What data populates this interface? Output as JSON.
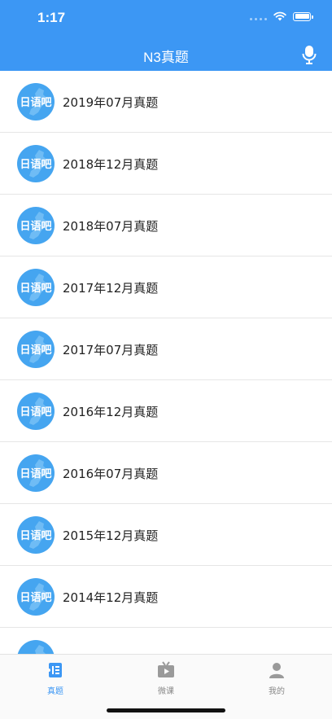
{
  "status": {
    "time": "1:17"
  },
  "nav": {
    "title": "N3真题"
  },
  "logo_text": "日语吧",
  "exams": [
    {
      "label": "2019年07月真题"
    },
    {
      "label": "2018年12月真题"
    },
    {
      "label": "2018年07月真题"
    },
    {
      "label": "2017年12月真题"
    },
    {
      "label": "2017年07月真题"
    },
    {
      "label": "2016年12月真题"
    },
    {
      "label": "2016年07月真题"
    },
    {
      "label": "2015年12月真题"
    },
    {
      "label": "2014年12月真题"
    },
    {
      "label": ""
    }
  ],
  "tabs": [
    {
      "label": "真题",
      "icon": "exam-icon"
    },
    {
      "label": "微课",
      "icon": "video-icon"
    },
    {
      "label": "我的",
      "icon": "user-icon"
    }
  ],
  "colors": {
    "accent": "#3c97f4",
    "logo_bg": "#45a5f0"
  }
}
